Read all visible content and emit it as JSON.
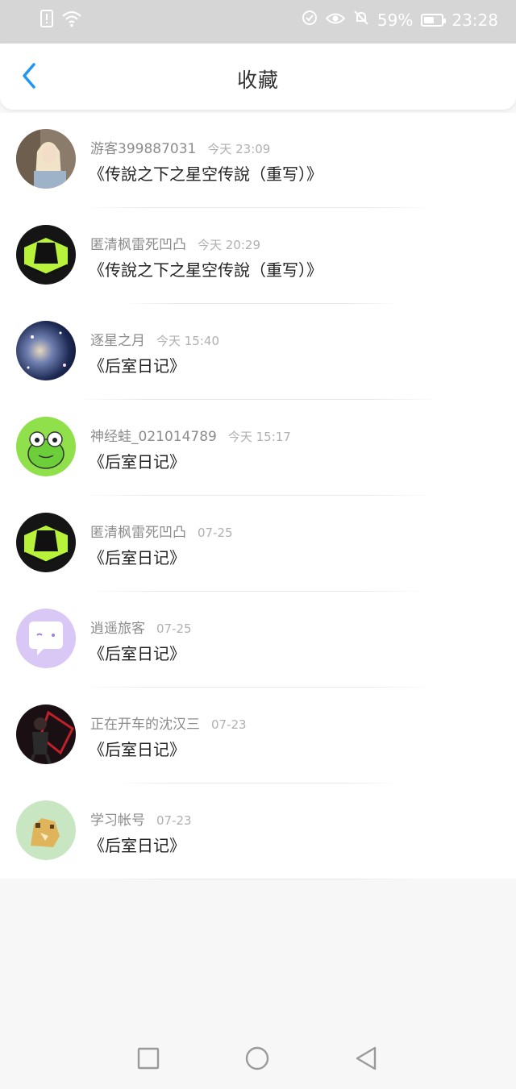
{
  "status_bar": {
    "battery_percent_label": "59%",
    "battery_level": 0.59,
    "time": "23:28",
    "icons": [
      "sim-alert-icon",
      "wifi-icon",
      "vpn-icon",
      "eye-icon",
      "mute-icon",
      "battery-icon"
    ]
  },
  "header": {
    "title": "收藏",
    "back_icon": "chevron-left-icon",
    "accent_color": "#2196f3"
  },
  "items": [
    {
      "user": "游客399887031",
      "time": "今天 23:09",
      "book": "《传說之下之星空传說（重写）》",
      "avatar": "photo-girl"
    },
    {
      "user": "匿清枫雷死凹凸",
      "time": "今天 20:29",
      "book": "《传說之下之星空传說（重写）》",
      "avatar": "green-cube"
    },
    {
      "user": "逐星之月",
      "time": "今天 15:40",
      "book": "《后室日记》",
      "avatar": "nebula"
    },
    {
      "user": "神经蛙_021014789",
      "time": "今天 15:17",
      "book": "《后室日记》",
      "avatar": "frog"
    },
    {
      "user": "匿清枫雷死凹凸",
      "time": "07-25",
      "book": "《后室日记》",
      "avatar": "green-cube"
    },
    {
      "user": "逍遥旅客",
      "time": "07-25",
      "book": "《后室日记》",
      "avatar": "purple-chat"
    },
    {
      "user": "正在开车的沈汉三",
      "time": "07-23",
      "book": "《后室日记》",
      "avatar": "dark-figure"
    },
    {
      "user": "学习帐号",
      "time": "07-23",
      "book": "《后室日记》",
      "avatar": "doge"
    }
  ],
  "nav_bar": {
    "icons": [
      "recent-apps-icon",
      "home-icon",
      "back-icon"
    ]
  }
}
